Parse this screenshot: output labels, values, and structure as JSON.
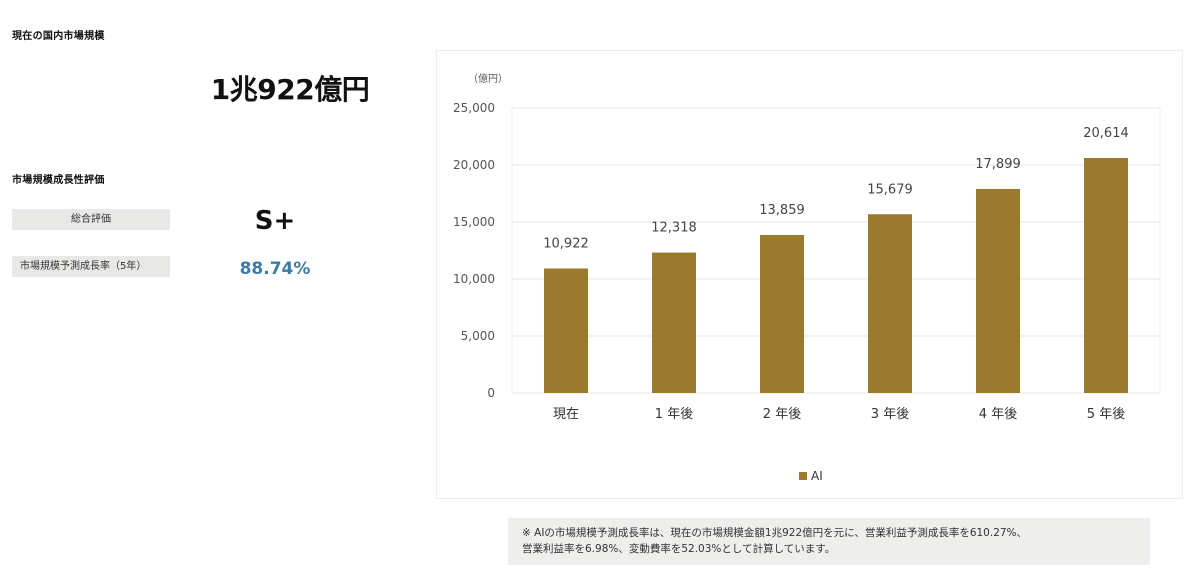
{
  "market": {
    "title": "現在の国内市場規模",
    "size": "1兆922億円"
  },
  "growth": {
    "title": "市場規模成長性評価",
    "overall_label": "総合評価",
    "overall_value": "S+",
    "rate_label": "市場規模予測成長率（5年）",
    "rate_value": "88.74%",
    "rate_color": "#3a7ca5"
  },
  "chart_data": {
    "type": "bar",
    "unit_label": "（億円）",
    "categories": [
      "現在",
      "1 年後",
      "2 年後",
      "3 年後",
      "4 年後",
      "5 年後"
    ],
    "series": [
      {
        "name": "AI",
        "color": "#9b7a2e",
        "values": [
          10922,
          12318,
          13859,
          15679,
          17899,
          20614
        ],
        "labels": [
          "10,922",
          "12,318",
          "13,859",
          "15,679",
          "17,899",
          "20,614"
        ]
      }
    ],
    "ylim": [
      0,
      25000
    ],
    "yticks": [
      0,
      5000,
      10000,
      15000,
      20000,
      25000
    ],
    "ytick_labels": [
      "0",
      "5,000",
      "10,000",
      "15,000",
      "20,000",
      "25,000"
    ],
    "grid": true,
    "legend": "bottom"
  },
  "note": {
    "line1": "※ AIの市場規模予測成長率は、現在の市場規模金額1兆922億円を元に、営業利益予測成長率を610.27%、",
    "line2": "営業利益率を6.98%、変動費率を52.03%として計算しています。"
  }
}
